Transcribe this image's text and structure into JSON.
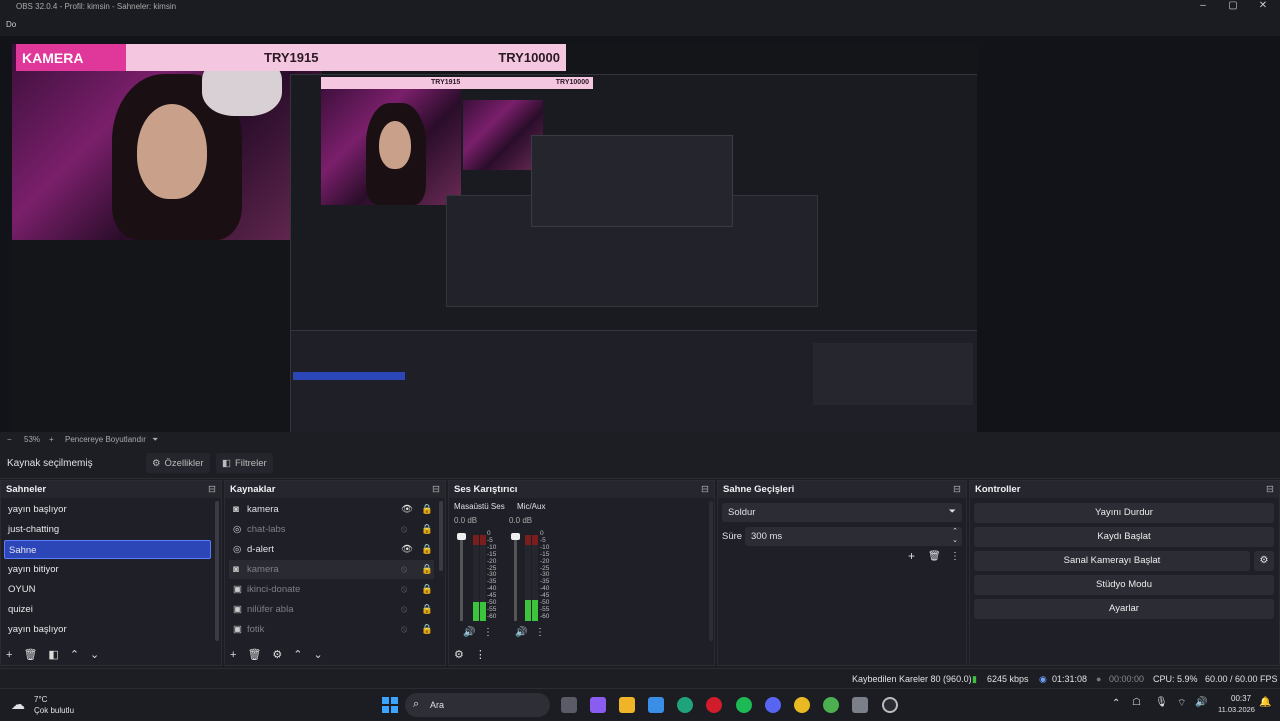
{
  "window": {
    "title": "OBS 32.0.4 - Profil: kimsin - Sahneler: kimsin",
    "menu_first": "Do"
  },
  "overlay": {
    "camera_label": "KAMERA",
    "value_1": "TRY1915",
    "value_2": "TRY10000"
  },
  "zoom": {
    "value": "53%",
    "minus": "−",
    "plus": "+",
    "fit_label": "Pencereye Boyutlandır"
  },
  "source_bar": {
    "status": "Kaynak seçilmemiş",
    "properties": "Özellikler",
    "filters": "Filtreler"
  },
  "scenes": {
    "title": "Sahneler",
    "items": [
      "yayın başlıyor",
      "just-chatting",
      "Sahne",
      "yayın bitiyor",
      "OYUN",
      "quizei",
      "yayın başlıyor"
    ],
    "selected": "Sahne"
  },
  "sources": {
    "title": "Kaynaklar",
    "items": [
      {
        "name": "kamera",
        "visible": true
      },
      {
        "name": "chat-labs",
        "visible": false
      },
      {
        "name": "d-alert",
        "visible": true
      },
      {
        "name": "kamera",
        "visible": false
      },
      {
        "name": "ikinci-donate",
        "visible": false
      },
      {
        "name": "nilüfer abla",
        "visible": false
      },
      {
        "name": "fotik",
        "visible": false
      }
    ]
  },
  "mixer": {
    "title": "Ses Karıştırıcı",
    "channels": [
      {
        "name": "Masaüstü Ses",
        "db": "0.0 dB",
        "level": 0.22
      },
      {
        "name": "Mic/Aux",
        "db": "0.0 dB",
        "level": 0.25
      }
    ],
    "scale": [
      "0",
      "-5",
      "-10",
      "-15",
      "-20",
      "-25",
      "-30",
      "-35",
      "-40",
      "-45",
      "-50",
      "-55",
      "-60"
    ]
  },
  "transitions": {
    "title": "Sahne Geçişleri",
    "selected": "Soldur",
    "duration_label": "Süre",
    "duration_value": "300 ms"
  },
  "controls": {
    "title": "Kontroller",
    "buttons": [
      "Yayını Durdur",
      "Kaydı Başlat",
      "Sanal Kamerayı Başlat",
      "Stüdyo Modu",
      "Ayarlar"
    ]
  },
  "status": {
    "dropped": "Kaybedilen Kareler 80 (960.0)",
    "bitrate": "6245 kbps",
    "stream_time": "01:31:08",
    "rec_time": "00:00:00",
    "cpu": "CPU: 5.9%",
    "fps": "60.00 / 60.00 FPS"
  },
  "taskbar": {
    "weather_temp": "7°C",
    "weather_desc": "Çok bulutlu",
    "search_placeholder": "Ara",
    "time": "00:37",
    "date": "11.03.2026"
  },
  "colors": {
    "accent": "#2c46b8",
    "banner": "#f5c6e0",
    "banner_label": "#e0389a",
    "meter_green": "#3cc43c",
    "meter_red": "#c02a2a"
  }
}
